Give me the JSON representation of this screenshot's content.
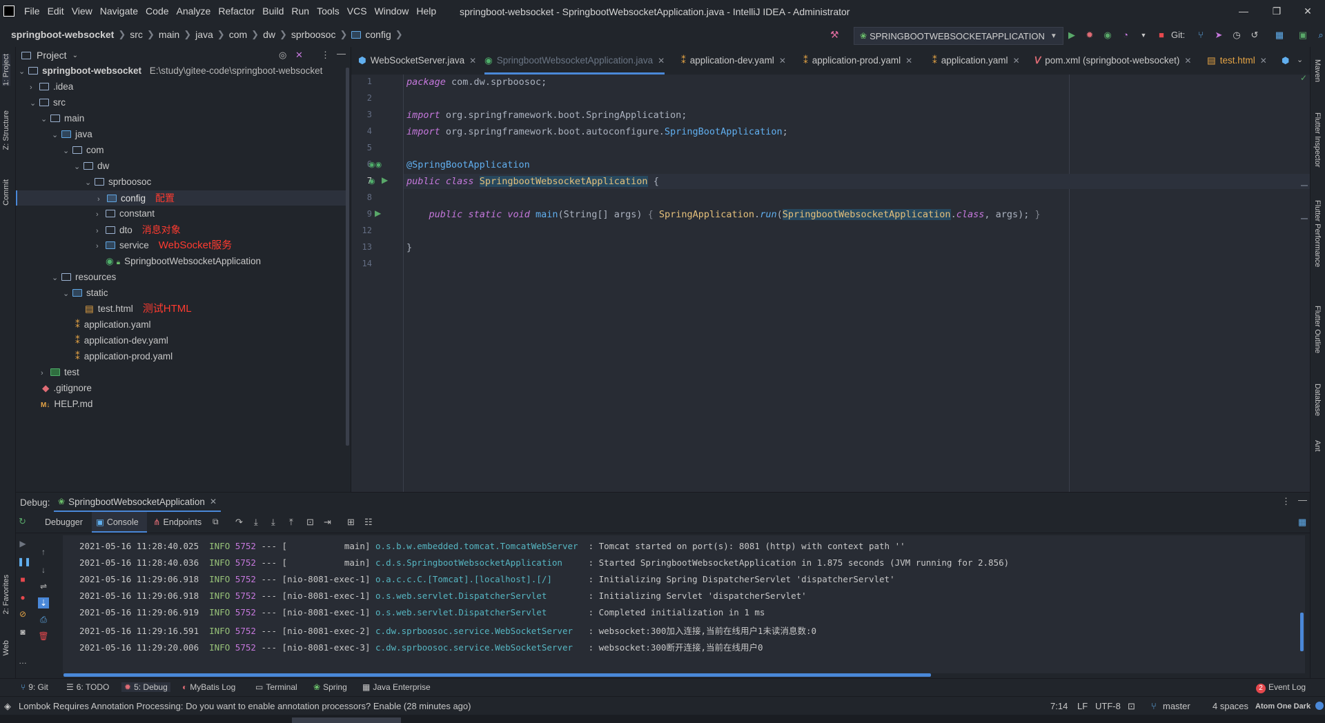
{
  "window": {
    "title": "springboot-websocket - SpringbootWebsocketApplication.java - IntelliJ IDEA - Administrator",
    "menu": [
      "File",
      "Edit",
      "View",
      "Navigate",
      "Code",
      "Analyze",
      "Refactor",
      "Build",
      "Run",
      "Tools",
      "VCS",
      "Window",
      "Help"
    ],
    "controls": {
      "minimize": "—",
      "restore": "❐",
      "close": "✕"
    }
  },
  "navbar": {
    "breadcrumbs": [
      "springboot-websocket",
      "src",
      "main",
      "java",
      "com",
      "dw",
      "sprboosoc",
      "config"
    ],
    "run_config": "SPRINGBOOTWEBSOCKETAPPLICATION",
    "git_label": "Git:"
  },
  "left_stripe": {
    "tabs": [
      "1: Project",
      "Z: Structure",
      "Commit",
      "2: Favorites",
      "Web"
    ]
  },
  "right_stripe": {
    "tabs": [
      "Maven",
      "Flutter Inspector",
      "Flutter Performance",
      "Flutter Outline",
      "Database",
      "Ant"
    ]
  },
  "project": {
    "header": "Project",
    "root_name": "springboot-websocket",
    "root_path": "E:\\study\\gitee-code\\springboot-websocket",
    "items": [
      {
        "label": ".idea",
        "annotation": ""
      },
      {
        "label": "src",
        "annotation": ""
      },
      {
        "label": "main",
        "annotation": ""
      },
      {
        "label": "java",
        "annotation": ""
      },
      {
        "label": "com",
        "annotation": ""
      },
      {
        "label": "dw",
        "annotation": ""
      },
      {
        "label": "sprboosoc",
        "annotation": ""
      },
      {
        "label": "config",
        "annotation": "配置"
      },
      {
        "label": "constant",
        "annotation": ""
      },
      {
        "label": "dto",
        "annotation": "消息对象"
      },
      {
        "label": "service",
        "annotation": "WebSocket服务"
      },
      {
        "label": "SpringbootWebsocketApplication",
        "annotation": ""
      },
      {
        "label": "resources",
        "annotation": ""
      },
      {
        "label": "static",
        "annotation": ""
      },
      {
        "label": "test.html",
        "annotation": "测试HTML"
      },
      {
        "label": "application.yaml",
        "annotation": ""
      },
      {
        "label": "application-dev.yaml",
        "annotation": ""
      },
      {
        "label": "application-prod.yaml",
        "annotation": ""
      },
      {
        "label": "test",
        "annotation": ""
      },
      {
        "label": ".gitignore",
        "annotation": ""
      },
      {
        "label": "HELP.md",
        "annotation": ""
      }
    ]
  },
  "editor_tabs": [
    {
      "label": "WebSocketServer.java"
    },
    {
      "label": "SpringbootWebsocketApplication.java"
    },
    {
      "label": "application-dev.yaml"
    },
    {
      "label": "application-prod.yaml"
    },
    {
      "label": "application.yaml"
    },
    {
      "label": "pom.xml (springboot-websocket)"
    },
    {
      "label": "test.html"
    }
  ],
  "code": {
    "line_numbers": [
      "1",
      "2",
      "3",
      "4",
      "5",
      "6",
      "7",
      "8",
      "9",
      "12",
      "13",
      "14"
    ],
    "package_kw": "package",
    "package_name": "com.dw.sprboosoc;",
    "import_kw": "import",
    "import1": "org.springframework.boot.SpringApplication;",
    "import2_pre": "org.springframework.boot.autoconfigure.",
    "import2_cls": "SpringBootApplication",
    "import2_end": ";",
    "annotation": "@SpringBootApplication",
    "public_kw": "public",
    "class_kw": "class",
    "class_name": "SpringbootWebsocketApplication",
    "brace_open": "{",
    "static_kw": "static",
    "void_kw": "void",
    "method": "main",
    "params": "(String[] args)",
    "body_open": "{",
    "app_cls": "SpringApplication",
    "run_fn": "run",
    "arg_cls": "SpringbootWebsocketApplication",
    "class_ref": "class",
    "args_end": ", args);",
    "body_close": "}",
    "brace_close": "}"
  },
  "debug": {
    "label": "Debug:",
    "session": "SpringbootWebsocketApplication",
    "tabs": [
      "Debugger",
      "Console",
      "Endpoints"
    ],
    "logs": [
      {
        "ts": "2021-05-16 11:28:40.025",
        "level": "INFO",
        "pid": "5752",
        "thread": "--- [           main]",
        "logger": "o.s.b.w.embedded.tomcat.TomcatWebServer ",
        "msg": ": Tomcat started on port(s): 8081 (http) with context path ''"
      },
      {
        "ts": "2021-05-16 11:28:40.036",
        "level": "INFO",
        "pid": "5752",
        "thread": "--- [           main]",
        "logger": "c.d.s.SpringbootWebsocketApplication    ",
        "msg": ": Started SpringbootWebsocketApplication in 1.875 seconds (JVM running for 2.856)"
      },
      {
        "ts": "2021-05-16 11:29:06.918",
        "level": "INFO",
        "pid": "5752",
        "thread": "--- [nio-8081-exec-1]",
        "logger": "o.a.c.c.C.[Tomcat].[localhost].[/]      ",
        "msg": ": Initializing Spring DispatcherServlet 'dispatcherServlet'"
      },
      {
        "ts": "2021-05-16 11:29:06.918",
        "level": "INFO",
        "pid": "5752",
        "thread": "--- [nio-8081-exec-1]",
        "logger": "o.s.web.servlet.DispatcherServlet       ",
        "msg": ": Initializing Servlet 'dispatcherServlet'"
      },
      {
        "ts": "2021-05-16 11:29:06.919",
        "level": "INFO",
        "pid": "5752",
        "thread": "--- [nio-8081-exec-1]",
        "logger": "o.s.web.servlet.DispatcherServlet       ",
        "msg": ": Completed initialization in 1 ms"
      },
      {
        "ts": "2021-05-16 11:29:16.591",
        "level": "INFO",
        "pid": "5752",
        "thread": "--- [nio-8081-exec-2]",
        "logger": "c.dw.sprboosoc.service.WebSocketServer  ",
        "msg": ": websocket:300加入连接,当前在线用户1未读消息数:0"
      },
      {
        "ts": "2021-05-16 11:29:20.006",
        "level": "INFO",
        "pid": "5752",
        "thread": "--- [nio-8081-exec-3]",
        "logger": "c.dw.sprboosoc.service.WebSocketServer  ",
        "msg": ": websocket:300断开连接,当前在线用户0"
      }
    ]
  },
  "bottom_tabs": [
    "9: Git",
    "6: TODO",
    "5: Debug",
    "MyBatis Log",
    "Terminal",
    "Spring",
    "Java Enterprise"
  ],
  "event_log": {
    "count": "2",
    "label": "Event Log"
  },
  "status": {
    "message": "Lombok Requires Annotation Processing: Do you want to enable annotation processors? Enable (28 minutes ago)",
    "position": "7:14",
    "line_sep": "LF",
    "encoding": "UTF-8",
    "branch": "master",
    "indent": "4 spaces",
    "theme": "Atom One Dark"
  },
  "colors": {
    "accent": "#4a88d8",
    "annotation_red": "#ff3b30",
    "background": "#282c34",
    "panel": "#21252b"
  }
}
